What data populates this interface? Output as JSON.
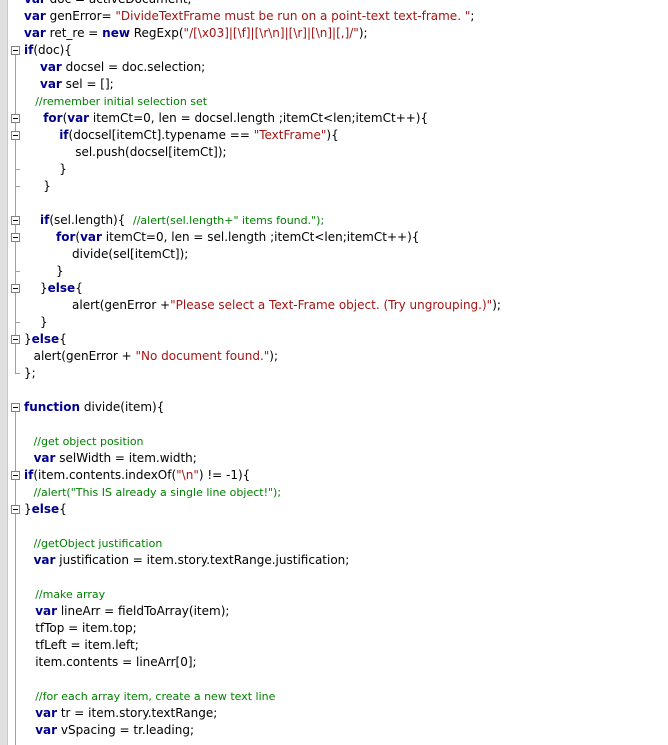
{
  "lines": [
    {
      "indent": 0,
      "tokens": [
        [
          "k",
          "var"
        ],
        [
          "t",
          " doc = activeDocument;"
        ]
      ]
    },
    {
      "indent": 0,
      "tokens": [
        [
          "k",
          "var"
        ],
        [
          "t",
          " genError= "
        ],
        [
          "s",
          "\"DivideTextFrame must be run on a point-text text-frame. \""
        ],
        [
          "t",
          ";"
        ]
      ]
    },
    {
      "indent": 0,
      "tokens": [
        [
          "k",
          "var"
        ],
        [
          "t",
          " ret_re = "
        ],
        [
          "k",
          "new"
        ],
        [
          "t",
          " RegExp("
        ],
        [
          "s",
          "\"/[\\x03]|[\\f]|[\\r\\n]|[\\r]|[\\n]|[,]/\""
        ],
        [
          "t",
          ");"
        ]
      ]
    },
    {
      "indent": 0,
      "tokens": [
        [
          "k",
          "if"
        ],
        [
          "t",
          "(doc){"
        ]
      ]
    },
    {
      "indent": 1,
      "tokens": [
        [
          "k",
          "var"
        ],
        [
          "t",
          " docsel = doc.selection;"
        ]
      ]
    },
    {
      "indent": 1,
      "tokens": [
        [
          "k",
          "var"
        ],
        [
          "t",
          " sel = [];"
        ]
      ]
    },
    {
      "indent": 0.7,
      "tokens": [
        [
          "c",
          "//remember initial selection set"
        ]
      ]
    },
    {
      "indent": 1.2,
      "tokens": [
        [
          "k",
          "for"
        ],
        [
          "t",
          "("
        ],
        [
          "k",
          "var"
        ],
        [
          "t",
          " itemCt=0, len = docsel.length ;itemCt<len;itemCt++){"
        ]
      ]
    },
    {
      "indent": 2.2,
      "tokens": [
        [
          "k",
          "if"
        ],
        [
          "t",
          "(docsel[itemCt].typename == "
        ],
        [
          "s",
          "\"TextFrame\""
        ],
        [
          "t",
          "){"
        ]
      ]
    },
    {
      "indent": 3.2,
      "tokens": [
        [
          "t",
          "sel.push(docsel[itemCt]);"
        ]
      ]
    },
    {
      "indent": 2.2,
      "tokens": [
        [
          "t",
          "}"
        ]
      ]
    },
    {
      "indent": 1.2,
      "tokens": [
        [
          "t",
          "}"
        ]
      ]
    },
    {
      "indent": 0,
      "tokens": []
    },
    {
      "indent": 1,
      "tokens": [
        [
          "k",
          "if"
        ],
        [
          "t",
          "(sel.length){  "
        ],
        [
          "c",
          "//alert(sel.length+\" items found.\");"
        ]
      ]
    },
    {
      "indent": 2,
      "tokens": [
        [
          "k",
          "for"
        ],
        [
          "t",
          "("
        ],
        [
          "k",
          "var"
        ],
        [
          "t",
          " itemCt=0, len = sel.length ;itemCt<len;itemCt++){"
        ]
      ]
    },
    {
      "indent": 3,
      "tokens": [
        [
          "t",
          "divide(sel[itemCt]);"
        ]
      ]
    },
    {
      "indent": 2,
      "tokens": [
        [
          "t",
          "}"
        ]
      ]
    },
    {
      "indent": 1,
      "tokens": [
        [
          "t",
          "}"
        ],
        [
          "k",
          "else"
        ],
        [
          "t",
          "{"
        ]
      ]
    },
    {
      "indent": 3,
      "tokens": [
        [
          "t",
          "alert(genError +"
        ],
        [
          "s",
          "\"Please select a Text-Frame object. (Try ungrouping.)\""
        ],
        [
          "t",
          ");"
        ]
      ]
    },
    {
      "indent": 1,
      "tokens": [
        [
          "t",
          "}"
        ]
      ]
    },
    {
      "indent": 0,
      "tokens": [
        [
          "t",
          "}"
        ],
        [
          "k",
          "else"
        ],
        [
          "t",
          "{"
        ]
      ]
    },
    {
      "indent": 0.6,
      "tokens": [
        [
          "t",
          "alert(genError + "
        ],
        [
          "s",
          "\"No document found.\""
        ],
        [
          "t",
          ");"
        ]
      ]
    },
    {
      "indent": 0,
      "tokens": [
        [
          "t",
          "};"
        ]
      ]
    },
    {
      "indent": 0,
      "tokens": []
    },
    {
      "indent": 0,
      "tokens": [
        [
          "k",
          "function"
        ],
        [
          "t",
          " divide(item){"
        ]
      ]
    },
    {
      "indent": 0,
      "tokens": []
    },
    {
      "indent": 0.6,
      "tokens": [
        [
          "c",
          "//get object position"
        ]
      ]
    },
    {
      "indent": 0.6,
      "tokens": [
        [
          "k",
          "var"
        ],
        [
          "t",
          " selWidth = item.width;"
        ]
      ]
    },
    {
      "indent": 0,
      "tokens": [
        [
          "k",
          "if"
        ],
        [
          "t",
          "(item.contents.indexOf("
        ],
        [
          "s",
          "\"\\n\""
        ],
        [
          "t",
          ") != -1){"
        ]
      ]
    },
    {
      "indent": 0.6,
      "tokens": [
        [
          "c",
          "//alert(\"This IS already a single line object!\");"
        ]
      ]
    },
    {
      "indent": 0,
      "tokens": [
        [
          "t",
          "}"
        ],
        [
          "k",
          "else"
        ],
        [
          "t",
          "{"
        ]
      ]
    },
    {
      "indent": 0,
      "tokens": []
    },
    {
      "indent": 0.6,
      "tokens": [
        [
          "c",
          "//getObject justification"
        ]
      ]
    },
    {
      "indent": 0.6,
      "tokens": [
        [
          "k",
          "var"
        ],
        [
          "t",
          " justification = item.story.textRange.justification;"
        ]
      ]
    },
    {
      "indent": 0,
      "tokens": []
    },
    {
      "indent": 0.7,
      "tokens": [
        [
          "c",
          "//make array"
        ]
      ]
    },
    {
      "indent": 0.7,
      "tokens": [
        [
          "k",
          "var"
        ],
        [
          "t",
          " lineArr = fieldToArray(item);"
        ]
      ]
    },
    {
      "indent": 0.7,
      "tokens": [
        [
          "t",
          "tfTop = item.top;"
        ]
      ]
    },
    {
      "indent": 0.7,
      "tokens": [
        [
          "t",
          "tfLeft = item.left;"
        ]
      ]
    },
    {
      "indent": 0.7,
      "tokens": [
        [
          "t",
          "item.contents = lineArr[0];"
        ]
      ]
    },
    {
      "indent": 0,
      "tokens": []
    },
    {
      "indent": 0.7,
      "tokens": [
        [
          "c",
          "//for each array item, create a new text line"
        ]
      ]
    },
    {
      "indent": 0.7,
      "tokens": [
        [
          "k",
          "var"
        ],
        [
          "t",
          " tr = item.story.textRange;"
        ]
      ]
    },
    {
      "indent": 0.7,
      "tokens": [
        [
          "k",
          "var"
        ],
        [
          "t",
          " vSpacing = tr.leading;"
        ]
      ]
    }
  ],
  "folds": [
    {
      "open": 3,
      "close": 22
    },
    {
      "open": 7,
      "close": 11
    },
    {
      "open": 8,
      "close": 10
    },
    {
      "open": 13,
      "close": 16
    },
    {
      "open": 14,
      "close": 16
    },
    {
      "open": 17,
      "close": 19
    },
    {
      "open": 20,
      "close": 22
    },
    {
      "open": 24,
      "close": 44
    },
    {
      "open": 28,
      "close": 30
    },
    {
      "open": 30,
      "close": 44
    }
  ],
  "colors": {
    "keyword": "#00008b",
    "string": "#a31515",
    "comment": "#008000",
    "text": "#000000"
  }
}
